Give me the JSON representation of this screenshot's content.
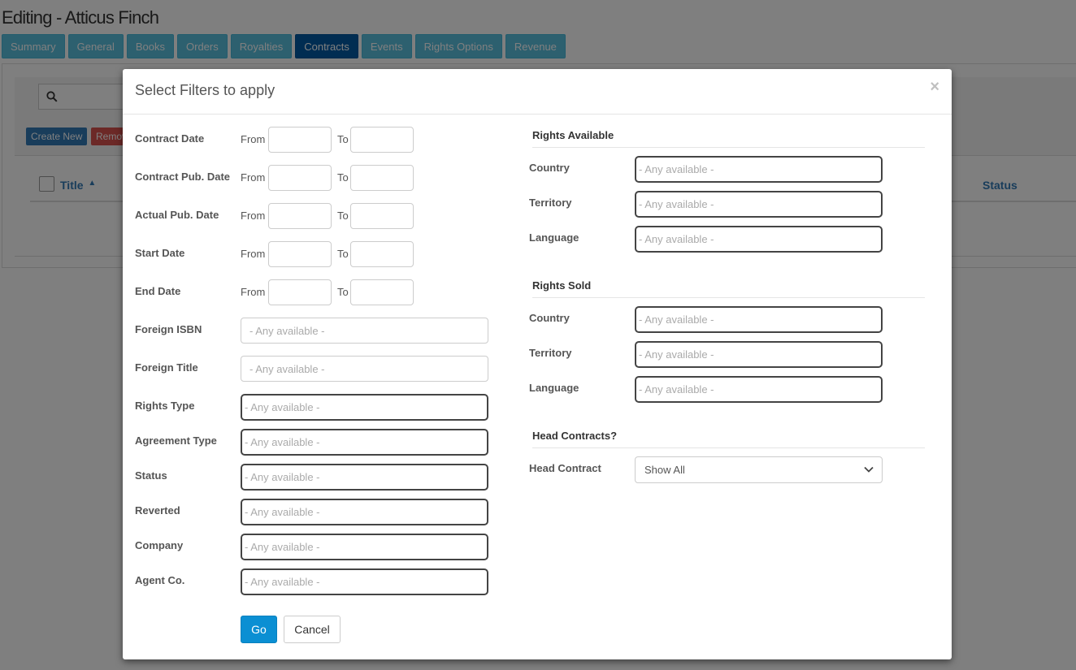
{
  "page": {
    "title": "Editing - Atticus Finch",
    "tabs": [
      {
        "label": "Summary"
      },
      {
        "label": "General"
      },
      {
        "label": "Books"
      },
      {
        "label": "Orders"
      },
      {
        "label": "Royalties"
      },
      {
        "label": "Contracts",
        "active": true
      },
      {
        "label": "Events"
      },
      {
        "label": "Rights Options"
      },
      {
        "label": "Revenue"
      }
    ],
    "toolbar": {
      "create_label": "Create New",
      "remove_label": "Remove"
    },
    "table": {
      "col_title": "Title",
      "col_title_sort": "▲",
      "col_status": "Status"
    }
  },
  "modal": {
    "title": "Select Filters to apply",
    "close": "×",
    "from_label": "From",
    "to_label": "To",
    "placeholder": "- Any available -",
    "date_filters": [
      {
        "label": "Contract Date"
      },
      {
        "label": "Contract Pub. Date"
      },
      {
        "label": "Actual Pub. Date"
      },
      {
        "label": "Start Date"
      },
      {
        "label": "End Date"
      }
    ],
    "text_filters": [
      {
        "label": "Foreign ISBN"
      },
      {
        "label": "Foreign Title"
      }
    ],
    "multi_filters": [
      {
        "label": "Rights Type"
      },
      {
        "label": "Agreement Type"
      },
      {
        "label": "Status"
      },
      {
        "label": "Reverted"
      },
      {
        "label": "Company"
      },
      {
        "label": "Agent Co."
      }
    ],
    "rights_available": {
      "heading": "Rights Available",
      "fields": [
        {
          "label": "Country"
        },
        {
          "label": "Territory"
        },
        {
          "label": "Language"
        }
      ]
    },
    "rights_sold": {
      "heading": "Rights Sold",
      "fields": [
        {
          "label": "Country"
        },
        {
          "label": "Territory"
        },
        {
          "label": "Language"
        }
      ]
    },
    "head_contracts": {
      "heading": "Head Contracts?",
      "label": "Head Contract",
      "selected": "Show All"
    },
    "go_label": "Go",
    "cancel_label": "Cancel"
  }
}
